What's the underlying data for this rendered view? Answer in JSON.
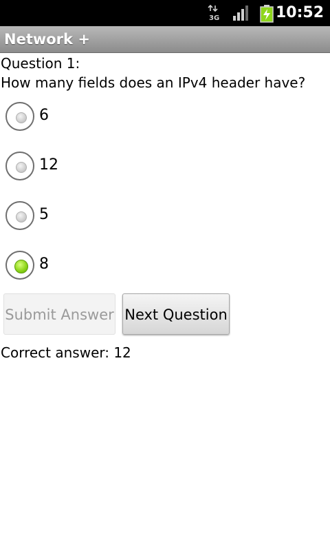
{
  "status_bar": {
    "network_type": "3G",
    "network_icon": "3g-data-icon",
    "signal_icon": "signal-strength-icon",
    "battery_icon": "battery-charging-icon",
    "time": "10:52"
  },
  "app": {
    "title": "Network +"
  },
  "question": {
    "label": "Question 1:",
    "text": "How many fields does an IPv4 header have?",
    "options": [
      {
        "label": "6",
        "checked": false
      },
      {
        "label": "12",
        "checked": false
      },
      {
        "label": "5",
        "checked": false
      },
      {
        "label": "8",
        "checked": true
      }
    ]
  },
  "buttons": {
    "submit_label": "Submit Answer",
    "submit_enabled": false,
    "next_label": "Next Question"
  },
  "result": {
    "text": "Correct answer: 12"
  },
  "colors": {
    "selected_radio": "#8fd61c",
    "title_bar": "#a0a0a0",
    "status_bar": "#000000"
  }
}
